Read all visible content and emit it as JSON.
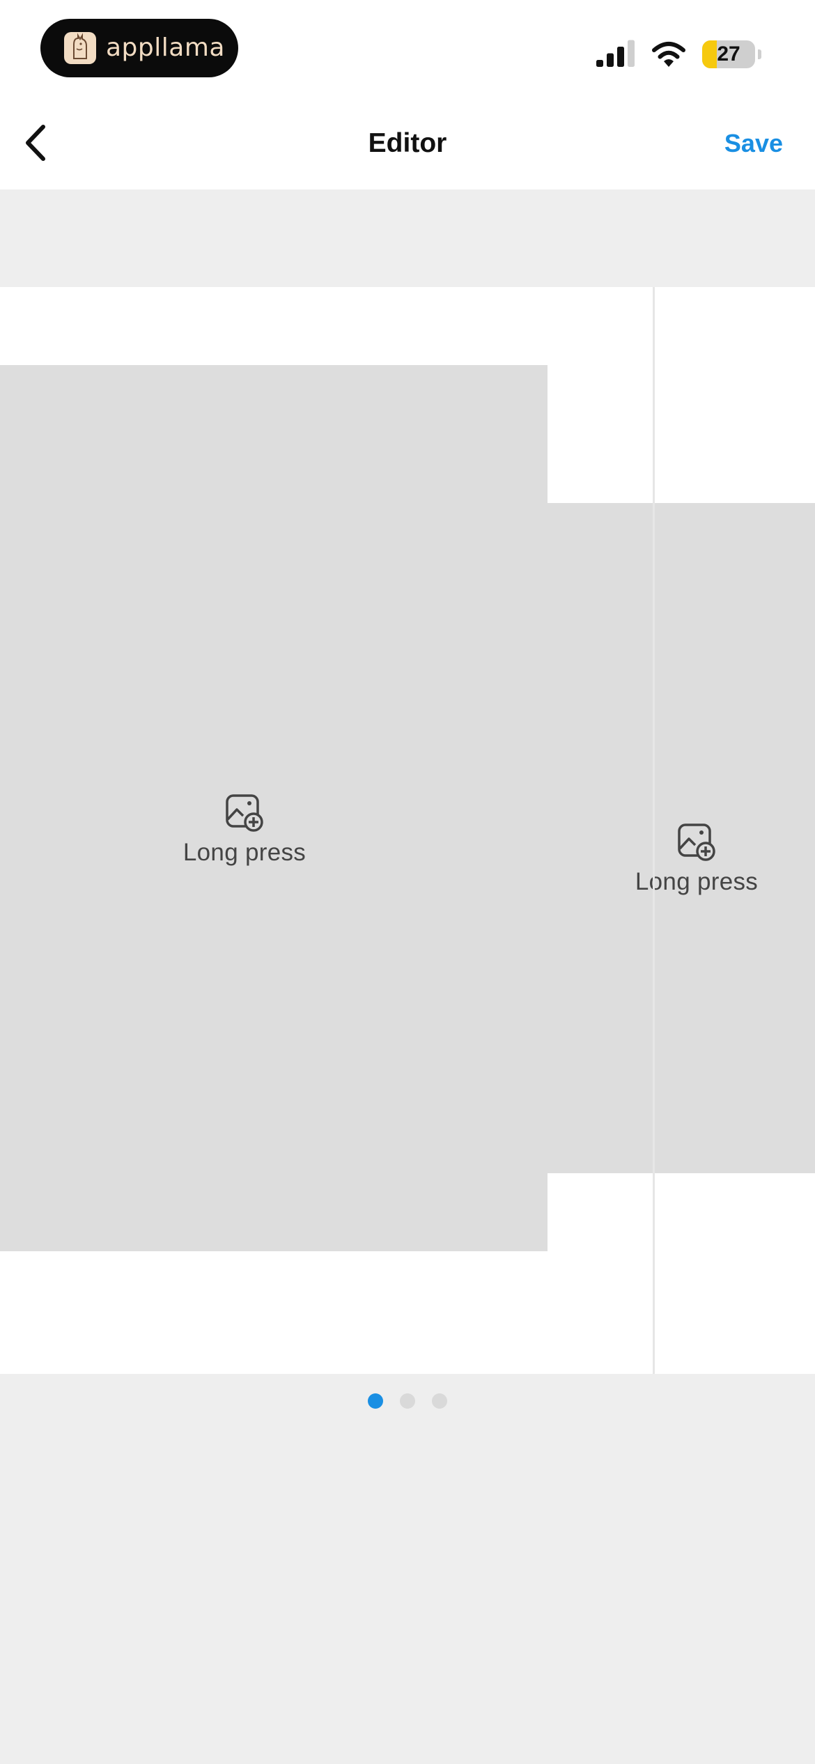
{
  "status_bar": {
    "brand_name": "appllama",
    "battery_level": 27,
    "battery_text": "27",
    "signal_bars_lit": 3,
    "signal_bars_total": 4
  },
  "nav": {
    "title": "Editor",
    "save_label": "Save",
    "back_icon": "chevron-left-icon"
  },
  "canvas": {
    "slots": [
      {
        "hint": "Long press",
        "icon": "add-photo-icon"
      },
      {
        "hint": "Long press",
        "icon": "add-photo-icon"
      }
    ]
  },
  "pager": {
    "page_count": 3,
    "active_index": 0
  },
  "colors": {
    "accent": "#1a8fe3",
    "brand_text": "#f2dcc3",
    "battery": "#f6c90e",
    "slot_fill": "#dddddd",
    "background": "#eeeeee"
  }
}
